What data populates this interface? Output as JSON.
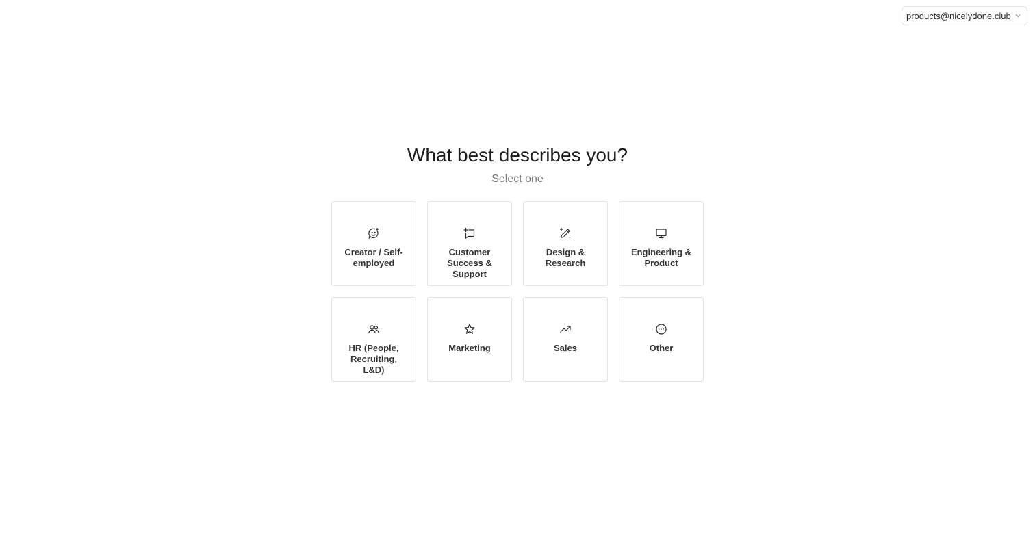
{
  "account": {
    "email": "products@nicelydone.club",
    "dropdown_icon": "chevron-down-icon"
  },
  "prompt": {
    "title": "What best describes you?",
    "subtitle": "Select one"
  },
  "options": [
    {
      "label": "Creator / Self-employed",
      "icon": "smile-sparkle-icon"
    },
    {
      "label": "Customer Success & Support",
      "icon": "message-plus-icon"
    },
    {
      "label": "Design & Research",
      "icon": "pen-sparkle-icon"
    },
    {
      "label": "Engineering & Product",
      "icon": "monitor-icon"
    },
    {
      "label": "HR (People, Recruiting, L&D)",
      "icon": "users-icon"
    },
    {
      "label": "Marketing",
      "icon": "star-icon"
    },
    {
      "label": "Sales",
      "icon": "trending-up-icon"
    },
    {
      "label": "Other",
      "icon": "more-circle-icon"
    }
  ]
}
